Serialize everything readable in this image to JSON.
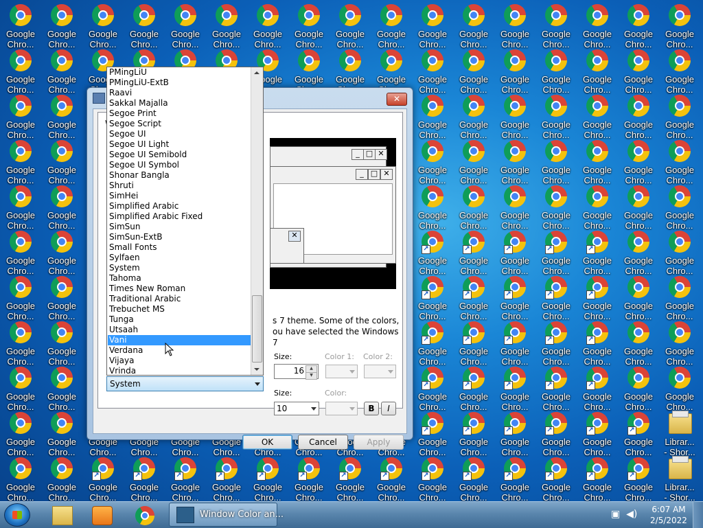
{
  "desktop": {
    "icon_label_line1": "Google",
    "icon_label_line2": "Chro...",
    "library_label_line1": "Librar...",
    "library_label_line2": "- Shor..."
  },
  "dialog": {
    "title": "",
    "tab_caption": "W",
    "description": "s 7 theme.  Some of the colors, ou have selected the Windows 7",
    "item": {
      "size_label": "Size:",
      "size_value": "16",
      "color1_label": "Color 1:",
      "color2_label": "Color 2:"
    },
    "font": {
      "size_label": "Size:",
      "size_value": "10",
      "color_label": "Color:",
      "bold_label": "B",
      "italic_label": "I"
    },
    "font_selected": "System",
    "buttons": {
      "ok": "OK",
      "cancel": "Cancel",
      "apply": "Apply"
    },
    "close_glyph": "✕"
  },
  "font_list": {
    "items": [
      "PMingLiU",
      "PMingLiU-ExtB",
      "Raavi",
      "Sakkal Majalla",
      "Segoe Print",
      "Segoe Script",
      "Segoe UI",
      "Segoe UI Light",
      "Segoe UI Semibold",
      "Segoe UI Symbol",
      "Shonar Bangla",
      "Shruti",
      "SimHei",
      "Simplified Arabic",
      "Simplified Arabic Fixed",
      "SimSun",
      "SimSun-ExtB",
      "Small Fonts",
      "Sylfaen",
      "System",
      "Tahoma",
      "Times New Roman",
      "Traditional Arabic",
      "Trebuchet MS",
      "Tunga",
      "Utsaah",
      "Vani",
      "Verdana",
      "Vijaya",
      "Vrinda"
    ],
    "highlighted": "Vani"
  },
  "taskbar": {
    "window_label": "Window Color an...",
    "time": "6:07 AM",
    "date": "2/5/2022"
  },
  "colors": {
    "selection": "#3399ff",
    "desktop": "#1a86d6"
  }
}
